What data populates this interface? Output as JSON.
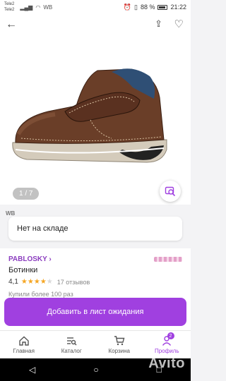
{
  "status_bar": {
    "carrier1": "Tele2",
    "carrier2": "Tele2",
    "battery": "88 %",
    "time": "21:22",
    "wb": "WB"
  },
  "image": {
    "counter": "1 / 7",
    "watermark": "WB"
  },
  "stock": {
    "text": "Нет на складе"
  },
  "product": {
    "brand": "PABLOSKY ›",
    "name": "Ботинки",
    "rating": "4,1",
    "rating_value": 4.1,
    "reviews": "17 отзывов",
    "bought": "Купили более 100 раз"
  },
  "cta": {
    "label": "Добавить в лист ожидания"
  },
  "bottom_nav": {
    "items": [
      {
        "label": "Главная",
        "icon": "home-icon"
      },
      {
        "label": "Каталог",
        "icon": "catalog-icon"
      },
      {
        "label": "Корзина",
        "icon": "cart-icon"
      },
      {
        "label": "Профиль",
        "icon": "profile-icon",
        "badge": "2",
        "active": true
      }
    ]
  },
  "overlay": {
    "avito": "Avito"
  },
  "colors": {
    "accent": "#a040e0",
    "brand": "#8b3dbf",
    "star": "#f5a623"
  }
}
